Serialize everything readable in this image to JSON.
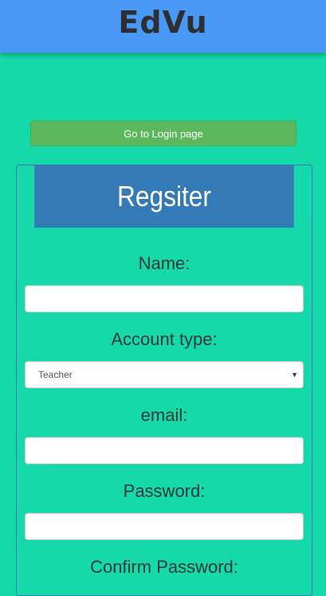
{
  "header": {
    "brand": "EdVu"
  },
  "actions": {
    "login_button_label": "Go to Login page"
  },
  "form": {
    "title": "Regsiter",
    "name_label": "Name:",
    "name_value": "",
    "account_type_label": "Account type:",
    "account_type_selected": "Teacher",
    "email_label": "email:",
    "email_value": "",
    "password_label": "Password:",
    "password_value": "",
    "confirm_password_label": "Confirm Password:"
  },
  "icons": {
    "select_caret": "triangle-down"
  },
  "colors": {
    "page_background": "#16d9a9",
    "header_background": "#4a98f6",
    "login_button": "#5cb85c",
    "panel_heading": "#337ab7"
  }
}
